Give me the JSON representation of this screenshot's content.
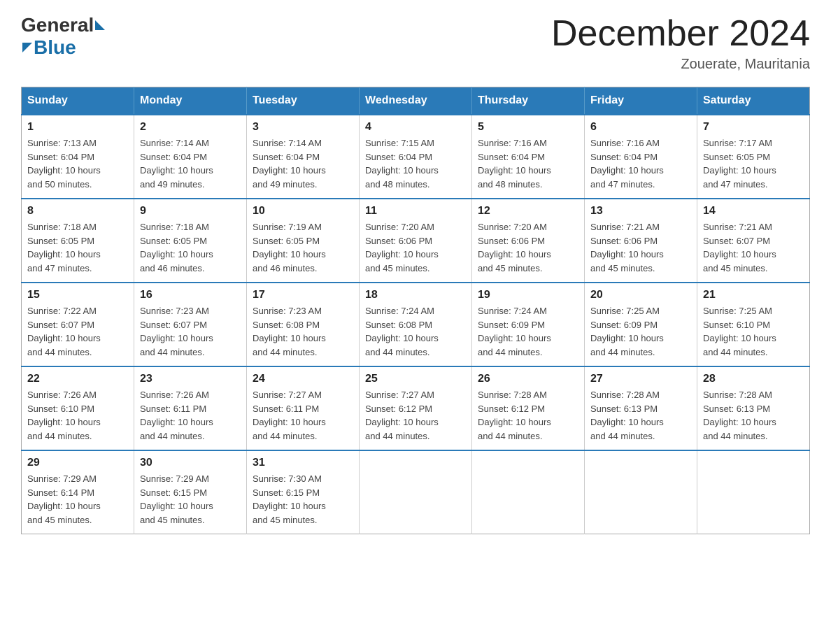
{
  "header": {
    "logo_general": "General",
    "logo_blue": "Blue",
    "month_title": "December 2024",
    "location": "Zouerate, Mauritania"
  },
  "weekdays": [
    "Sunday",
    "Monday",
    "Tuesday",
    "Wednesday",
    "Thursday",
    "Friday",
    "Saturday"
  ],
  "weeks": [
    [
      {
        "day": "1",
        "sunrise": "7:13 AM",
        "sunset": "6:04 PM",
        "daylight": "10 hours and 50 minutes."
      },
      {
        "day": "2",
        "sunrise": "7:14 AM",
        "sunset": "6:04 PM",
        "daylight": "10 hours and 49 minutes."
      },
      {
        "day": "3",
        "sunrise": "7:14 AM",
        "sunset": "6:04 PM",
        "daylight": "10 hours and 49 minutes."
      },
      {
        "day": "4",
        "sunrise": "7:15 AM",
        "sunset": "6:04 PM",
        "daylight": "10 hours and 48 minutes."
      },
      {
        "day": "5",
        "sunrise": "7:16 AM",
        "sunset": "6:04 PM",
        "daylight": "10 hours and 48 minutes."
      },
      {
        "day": "6",
        "sunrise": "7:16 AM",
        "sunset": "6:04 PM",
        "daylight": "10 hours and 47 minutes."
      },
      {
        "day": "7",
        "sunrise": "7:17 AM",
        "sunset": "6:05 PM",
        "daylight": "10 hours and 47 minutes."
      }
    ],
    [
      {
        "day": "8",
        "sunrise": "7:18 AM",
        "sunset": "6:05 PM",
        "daylight": "10 hours and 47 minutes."
      },
      {
        "day": "9",
        "sunrise": "7:18 AM",
        "sunset": "6:05 PM",
        "daylight": "10 hours and 46 minutes."
      },
      {
        "day": "10",
        "sunrise": "7:19 AM",
        "sunset": "6:05 PM",
        "daylight": "10 hours and 46 minutes."
      },
      {
        "day": "11",
        "sunrise": "7:20 AM",
        "sunset": "6:06 PM",
        "daylight": "10 hours and 45 minutes."
      },
      {
        "day": "12",
        "sunrise": "7:20 AM",
        "sunset": "6:06 PM",
        "daylight": "10 hours and 45 minutes."
      },
      {
        "day": "13",
        "sunrise": "7:21 AM",
        "sunset": "6:06 PM",
        "daylight": "10 hours and 45 minutes."
      },
      {
        "day": "14",
        "sunrise": "7:21 AM",
        "sunset": "6:07 PM",
        "daylight": "10 hours and 45 minutes."
      }
    ],
    [
      {
        "day": "15",
        "sunrise": "7:22 AM",
        "sunset": "6:07 PM",
        "daylight": "10 hours and 44 minutes."
      },
      {
        "day": "16",
        "sunrise": "7:23 AM",
        "sunset": "6:07 PM",
        "daylight": "10 hours and 44 minutes."
      },
      {
        "day": "17",
        "sunrise": "7:23 AM",
        "sunset": "6:08 PM",
        "daylight": "10 hours and 44 minutes."
      },
      {
        "day": "18",
        "sunrise": "7:24 AM",
        "sunset": "6:08 PM",
        "daylight": "10 hours and 44 minutes."
      },
      {
        "day": "19",
        "sunrise": "7:24 AM",
        "sunset": "6:09 PM",
        "daylight": "10 hours and 44 minutes."
      },
      {
        "day": "20",
        "sunrise": "7:25 AM",
        "sunset": "6:09 PM",
        "daylight": "10 hours and 44 minutes."
      },
      {
        "day": "21",
        "sunrise": "7:25 AM",
        "sunset": "6:10 PM",
        "daylight": "10 hours and 44 minutes."
      }
    ],
    [
      {
        "day": "22",
        "sunrise": "7:26 AM",
        "sunset": "6:10 PM",
        "daylight": "10 hours and 44 minutes."
      },
      {
        "day": "23",
        "sunrise": "7:26 AM",
        "sunset": "6:11 PM",
        "daylight": "10 hours and 44 minutes."
      },
      {
        "day": "24",
        "sunrise": "7:27 AM",
        "sunset": "6:11 PM",
        "daylight": "10 hours and 44 minutes."
      },
      {
        "day": "25",
        "sunrise": "7:27 AM",
        "sunset": "6:12 PM",
        "daylight": "10 hours and 44 minutes."
      },
      {
        "day": "26",
        "sunrise": "7:28 AM",
        "sunset": "6:12 PM",
        "daylight": "10 hours and 44 minutes."
      },
      {
        "day": "27",
        "sunrise": "7:28 AM",
        "sunset": "6:13 PM",
        "daylight": "10 hours and 44 minutes."
      },
      {
        "day": "28",
        "sunrise": "7:28 AM",
        "sunset": "6:13 PM",
        "daylight": "10 hours and 44 minutes."
      }
    ],
    [
      {
        "day": "29",
        "sunrise": "7:29 AM",
        "sunset": "6:14 PM",
        "daylight": "10 hours and 45 minutes."
      },
      {
        "day": "30",
        "sunrise": "7:29 AM",
        "sunset": "6:15 PM",
        "daylight": "10 hours and 45 minutes."
      },
      {
        "day": "31",
        "sunrise": "7:30 AM",
        "sunset": "6:15 PM",
        "daylight": "10 hours and 45 minutes."
      },
      null,
      null,
      null,
      null
    ]
  ],
  "labels": {
    "sunrise": "Sunrise:",
    "sunset": "Sunset:",
    "daylight": "Daylight:"
  }
}
